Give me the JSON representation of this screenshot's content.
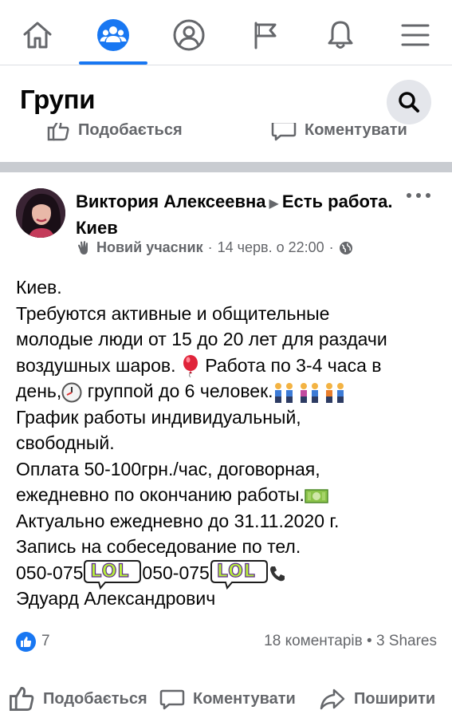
{
  "nav": {
    "items": [
      {
        "icon": "home-icon",
        "active": false
      },
      {
        "icon": "groups-icon",
        "active": true
      },
      {
        "icon": "profile-icon",
        "active": false
      },
      {
        "icon": "pages-flag-icon",
        "active": false
      },
      {
        "icon": "notifications-bell-icon",
        "active": false
      },
      {
        "icon": "menu-icon",
        "active": false
      }
    ],
    "accent_color": "#1877f2"
  },
  "header": {
    "title": "Групи"
  },
  "previous_post": {
    "like_label": "Подобається",
    "comment_label": "Коментувати"
  },
  "post": {
    "author": "Виктория Алексеевна",
    "group": "Есть работа. Киев",
    "badge": "Новий учасник",
    "separator": "·",
    "timestamp": "14 черв. о 22:00",
    "privacy_icon": "globe-icon",
    "body_lines": [
      "Киев.",
      "Требуются активные и общительные",
      "молодые люди от 15 до 20 лет для раздачи",
      "воздушных шаров.",
      "Работа по 3-4 часа в",
      "день,",
      "группой до 6 человек.",
      "График работы индивидуальный,",
      "свободный.",
      "Оплата 50-100грн./час, договорная,",
      "ежедневно по окончанию работы.",
      "Актуально ежедневно до 31.11.2020 г.",
      "Запись на собеседование по тел.",
      "050-075",
      "050-075",
      "Эдуард Александрович"
    ],
    "sticker_text": "LOL",
    "emojis": [
      "balloon",
      "clock",
      "people-holding-hands",
      "money"
    ],
    "likes": "7",
    "comments_shares": "18 коментарів • 3 Shares"
  },
  "actions": {
    "like_label": "Подобається",
    "comment_label": "Коментувати",
    "share_label": "Поширити"
  }
}
